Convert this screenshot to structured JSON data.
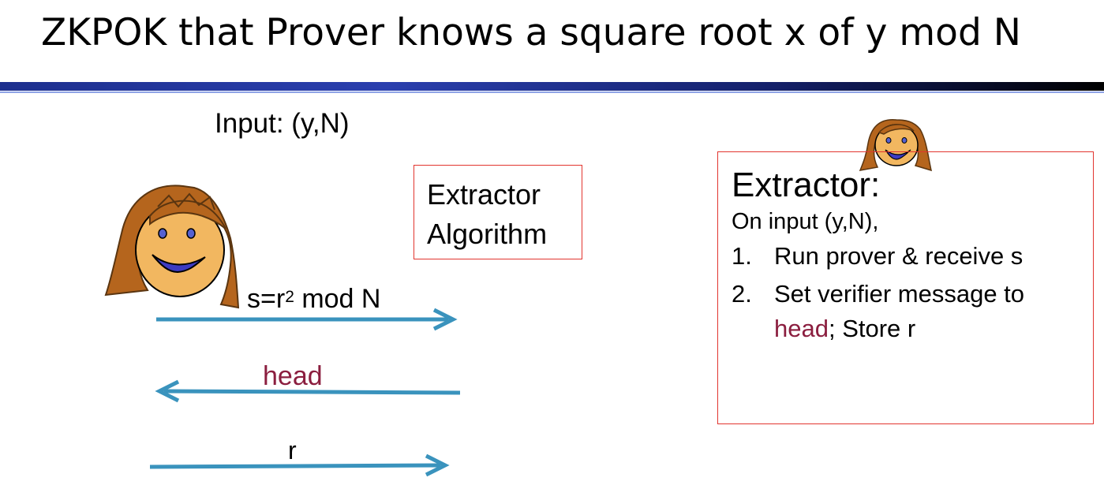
{
  "slide": {
    "title": "ZKPOK that Prover knows a square root x of y mod N",
    "input_label": "Input: (y,N)"
  },
  "extractor_algorithm_box": {
    "text": "Extractor\nAlgorithm"
  },
  "extractor_box": {
    "heading": "Extractor:",
    "intro": "On input (y,N),",
    "steps": [
      {
        "number": "1.",
        "text": "Run prover & receive s"
      },
      {
        "number": "2.",
        "line1": "Set verifier message to",
        "head_word": "head",
        "line2_rest": "; Store r"
      }
    ]
  },
  "messages": {
    "first": {
      "prefix": "s=r",
      "exponent": "2",
      "suffix": " mod N",
      "direction": "right"
    },
    "second": {
      "text": "head",
      "direction": "left"
    },
    "third": {
      "text": "r",
      "direction": "right"
    }
  },
  "icons": {
    "prover": "prover-face-icon",
    "extractor": "extractor-face-icon"
  },
  "colors": {
    "arrow": "#3a93bd",
    "box_border": "#e2352f",
    "head_text": "#8b1e3f",
    "hair": "#b5651d",
    "face": "#f2b760",
    "title_rule": "#1d2f8e"
  }
}
